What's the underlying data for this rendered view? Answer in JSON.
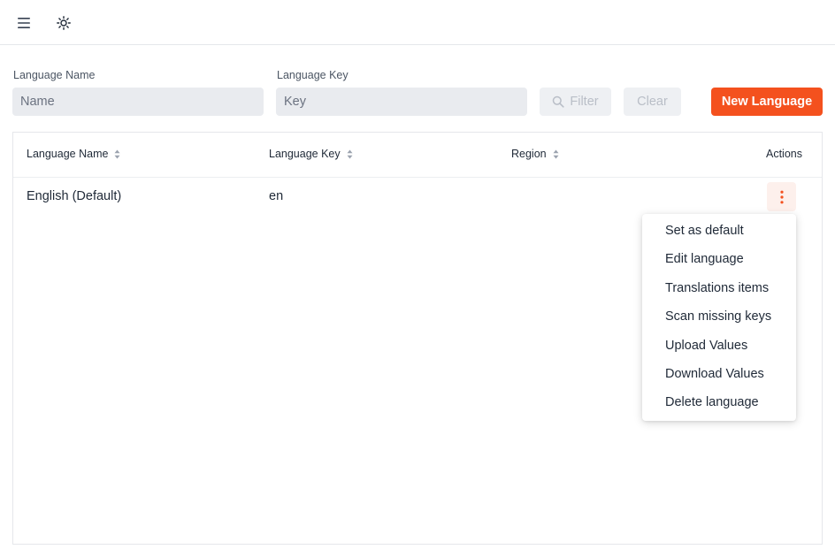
{
  "filters": {
    "language_name_label": "Language Name",
    "language_name_placeholder": "Name",
    "language_key_label": "Language Key",
    "language_key_placeholder": "Key",
    "filter_button": "Filter",
    "clear_button": "Clear",
    "new_button": "New Language"
  },
  "table": {
    "columns": [
      "Language Name",
      "Language Key",
      "Region",
      "Actions"
    ],
    "rows": [
      {
        "name": "English (Default)",
        "key": "en",
        "region": ""
      }
    ]
  },
  "actions_menu": {
    "items": [
      "Set as default",
      "Edit language",
      "Translations items",
      "Scan missing keys",
      "Upload Values",
      "Download Values",
      "Delete language"
    ]
  },
  "icons": {
    "menu": "hamburger-icon",
    "theme": "sun-icon",
    "filter": "search-icon",
    "sort": "sort-icon",
    "row_actions": "kebab-icon"
  },
  "colors": {
    "accent": "#f4511e",
    "accent_soft": "#fdf0ec",
    "input_bg": "#e9ebef",
    "disabled_text": "#b9bec7"
  }
}
